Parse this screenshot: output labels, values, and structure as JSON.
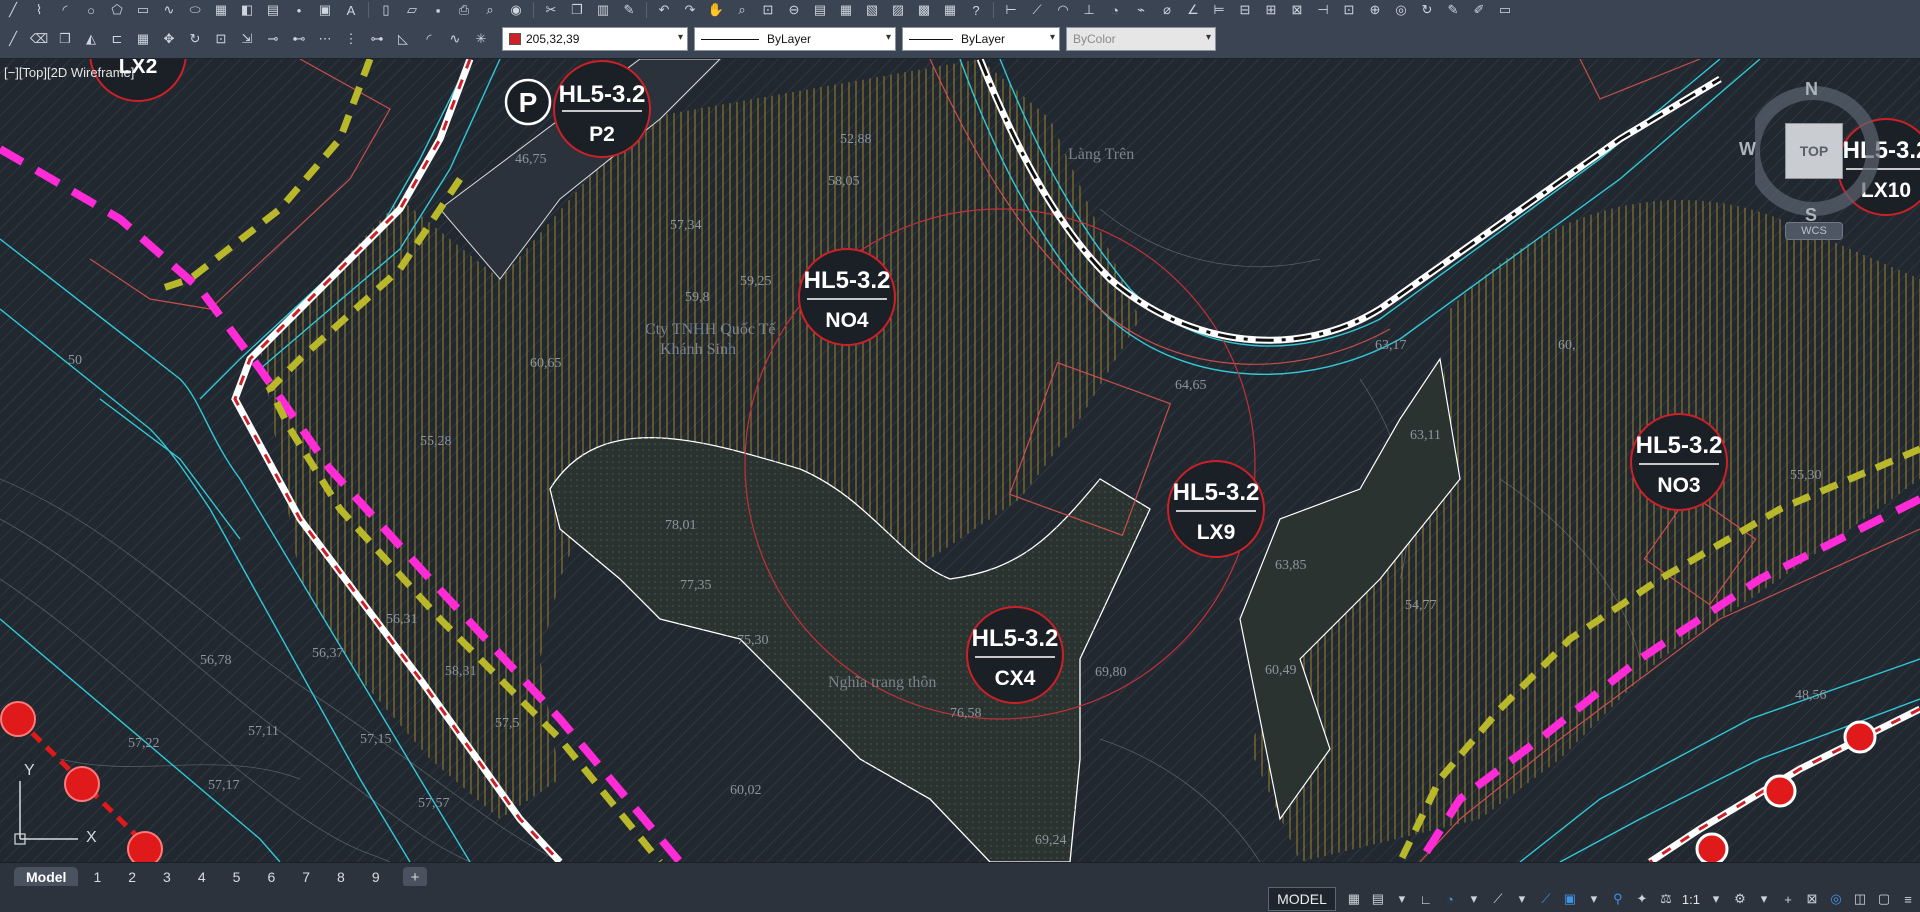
{
  "toolbar": {
    "color_value": "205,32,39",
    "linetype_value": "ByLayer",
    "lineweight_value": "ByLayer",
    "plotstyle_value": "ByColor"
  },
  "viewport": {
    "label": "[−][Top][2D Wireframe]",
    "nav_cube": {
      "north": "N",
      "south": "S",
      "west": "W",
      "top": "TOP",
      "wcs": "WCS"
    },
    "ucs": {
      "x": "X",
      "y": "Y"
    }
  },
  "drawing": {
    "bubbles": [
      {
        "code": "HL5-3.2",
        "sub": "P2"
      },
      {
        "code": "HL5-3.2",
        "sub": "NO4"
      },
      {
        "code": "HL5-3.2",
        "sub": "LX9"
      },
      {
        "code": "HL5-3.2",
        "sub": "CX4"
      },
      {
        "code": "HL5-3.2",
        "sub": "NO3"
      },
      {
        "code": "HL5-3.2",
        "sub": "LX10"
      },
      {
        "code": "",
        "sub": "LX2"
      }
    ],
    "parking_label": "P",
    "elevations": [
      "46,75",
      "52,88",
      "58,05",
      "57,34",
      "59,25",
      "59,8",
      "64,65",
      "63,17",
      "60,",
      "55,30",
      "78,01",
      "77,35",
      "75,30",
      "76,58",
      "69,80",
      "69,24",
      "60,49",
      "54,77",
      "63,85",
      "48,56",
      "56,78",
      "56,37",
      "57,22",
      "57,11",
      "57,15",
      "57,17",
      "57,57",
      "60,02",
      "58,31",
      "56,31",
      "55,28",
      "50",
      "57,5",
      "60,65",
      "63,11"
    ],
    "place_names": [
      "Làng Trên",
      "Cty TNHH Quốc Tế",
      "Khánh Sinh",
      "Nghĩa trang thôn"
    ]
  },
  "layout_tabs": [
    "Model",
    "1",
    "2",
    "3",
    "4",
    "5",
    "6",
    "7",
    "8",
    "9",
    "+"
  ],
  "status": {
    "model": "MODEL",
    "scale": "1:1"
  },
  "colors": {
    "background": "#212830",
    "ui_panel": "#3b4453",
    "bubble_border": "#cd2027",
    "hatch": "#c9a227",
    "magenta": "#ff2bd6",
    "yellow_dash": "#b8b82a",
    "cyan": "#32c8d6"
  }
}
